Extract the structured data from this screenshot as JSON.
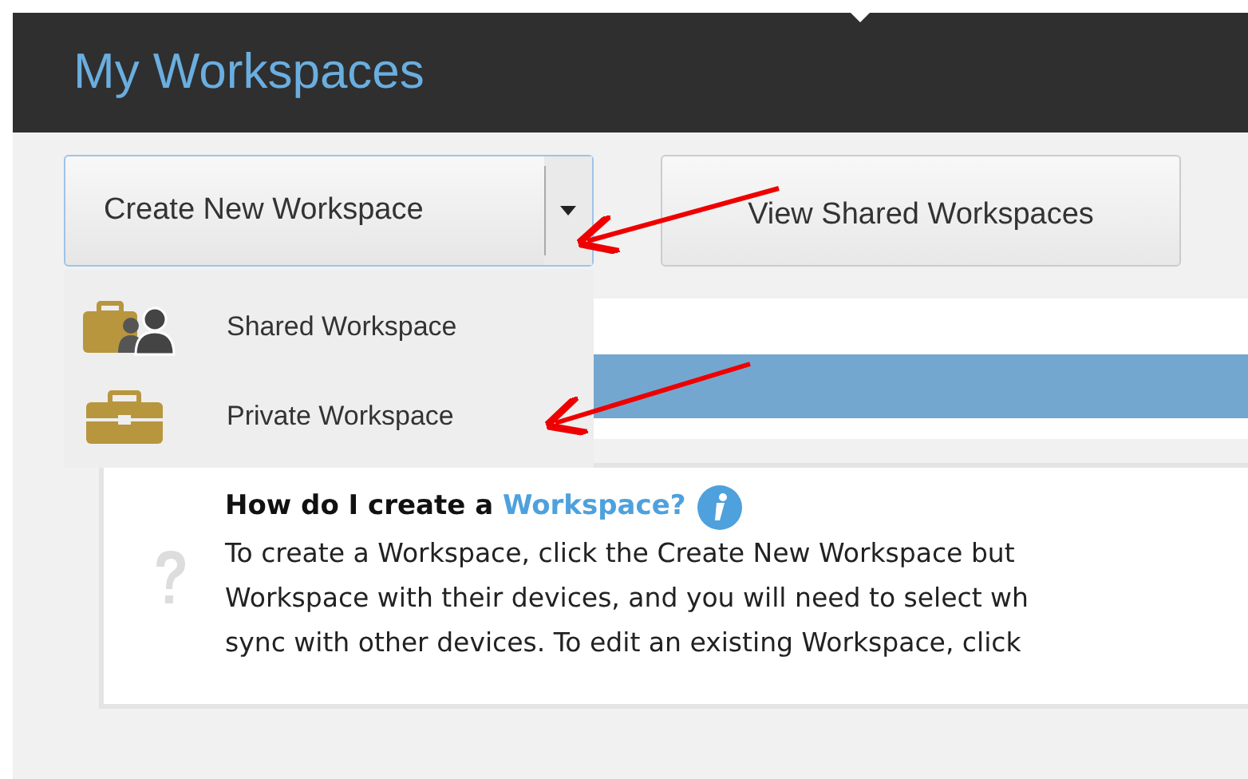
{
  "header": {
    "title": "My Workspaces"
  },
  "toolbar": {
    "split_button": {
      "label": "Create New Workspace",
      "expanded": true
    },
    "view_button": {
      "label": "View Shared Workspaces"
    }
  },
  "dropdown": [
    {
      "kind": "shared",
      "label": "Shared Workspace"
    },
    {
      "kind": "private",
      "label": "Private Workspace"
    }
  ],
  "help": {
    "heading_prefix": "How do I create a",
    "heading_link": "Workspace?",
    "lines": [
      "To create a Workspace, click the Create New Workspace but",
      "Workspace with their devices, and you will need to select wh",
      "sync with other devices. To edit an existing Workspace, click"
    ]
  }
}
